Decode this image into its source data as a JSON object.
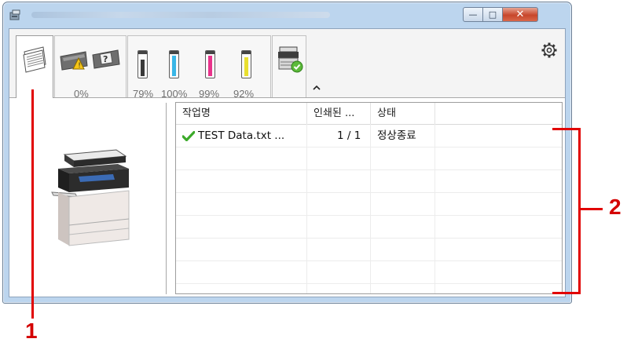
{
  "window": {
    "title": "",
    "controls": {
      "minimize": "—",
      "maximize": "□",
      "close": "✕"
    }
  },
  "toolbar": {
    "tabs": [
      {
        "id": "jobs",
        "icon": "document-stack-icon",
        "active": true
      },
      {
        "id": "alerts",
        "icon": "printer-warning-icon",
        "label": "0%"
      },
      {
        "id": "toner",
        "icon": "toner-icon",
        "levels": [
          {
            "color": "black",
            "hex": "#3a3a3a",
            "label": "79%",
            "value": 79
          },
          {
            "color": "cyan",
            "hex": "#39b6e6",
            "label": "100%",
            "value": 100
          },
          {
            "color": "magenta",
            "hex": "#e8338b",
            "label": "99%",
            "value": 99
          },
          {
            "color": "yellow",
            "hex": "#e9df2f",
            "label": "92%",
            "value": 92
          }
        ]
      },
      {
        "id": "device",
        "icon": "device-ok-icon"
      }
    ],
    "collapse_icon": "chevron-up-icon",
    "settings_icon": "gear-icon"
  },
  "job_list": {
    "columns": [
      "작업명",
      "인쇄된 ...",
      "상태"
    ],
    "rows": [
      {
        "status_icon": "checkmark-icon",
        "name": "TEST Data.txt ...",
        "printed": "1 / 1",
        "status": "정상종료"
      }
    ]
  },
  "callouts": {
    "one": "1",
    "two": "2"
  },
  "colors": {
    "accent_red": "#e10000",
    "check_green": "#3caa2a"
  }
}
